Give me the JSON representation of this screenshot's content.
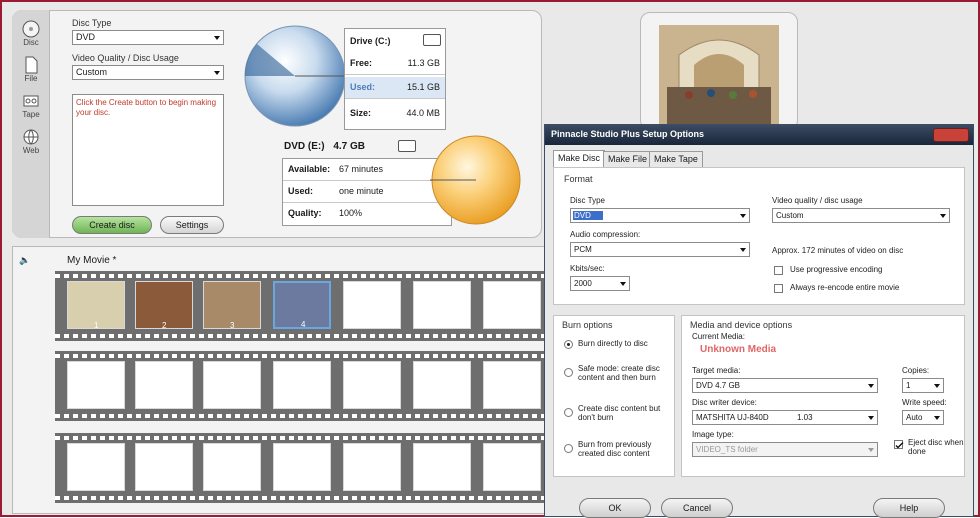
{
  "sidebar": {
    "items": [
      {
        "label": "Disc",
        "icon": "disc-icon"
      },
      {
        "label": "File",
        "icon": "file-icon"
      },
      {
        "label": "Tape",
        "icon": "tape-icon"
      },
      {
        "label": "Web",
        "icon": "web-icon"
      }
    ]
  },
  "disc_panel": {
    "disc_type_label": "Disc Type",
    "disc_type_value": "DVD",
    "quality_label": "Video Quality / Disc Usage",
    "quality_value": "Custom",
    "message": "Click the Create button to begin making your disc.",
    "create_button": "Create disc",
    "settings_button": "Settings"
  },
  "drive_info": {
    "title": "Drive (C:)",
    "free_label": "Free:",
    "free_value": "11.3 GB",
    "used_label": "Used:",
    "used_value": "15.1 GB",
    "size_label": "Size:",
    "size_value": "44.0 MB"
  },
  "dvd_info": {
    "title": "DVD (E:)",
    "capacity": "4.7 GB",
    "available_label": "Available:",
    "available_value": "67 minutes",
    "used_label": "Used:",
    "used_value": "one minute",
    "quality_label": "Quality:",
    "quality_value": "100%"
  },
  "timeline": {
    "title": "My Movie *",
    "clips": [
      "1",
      "2",
      "3",
      "4"
    ]
  },
  "dialog": {
    "title": "Pinnacle Studio Plus Setup Options",
    "tabs": [
      "Make Disc",
      "Make File",
      "Make Tape"
    ],
    "format_group": "Format",
    "disc_type_label": "Disc Type",
    "disc_type_value": "DVD",
    "video_quality_label": "Video quality / disc usage",
    "video_quality_value": "Custom",
    "audio_label": "Audio compression:",
    "audio_value": "PCM",
    "approx_text": "Approx. 172 minutes of video on disc",
    "kbits_label": "Kbits/sec:",
    "kbits_value": "2000",
    "progressive_label": "Use progressive encoding",
    "reencode_label": "Always re-encode entire movie",
    "burn_group": "Burn options",
    "burn_options": [
      "Burn directly to disc",
      "Safe mode: create disc content and then burn",
      "Create disc content but don't burn",
      "Burn from previously created disc content"
    ],
    "media_group": "Media and device options",
    "current_media_label": "Current Media:",
    "current_media_value": "Unknown Media",
    "target_label": "Target media:",
    "target_value": "DVD 4.7 GB",
    "copies_label": "Copies:",
    "copies_value": "1",
    "writer_label": "Disc writer device:",
    "writer_value": "MATSHITA UJ-840D",
    "writer_ver": "1.03",
    "speed_label": "Write speed:",
    "speed_value": "Auto",
    "image_label": "Image type:",
    "image_value": "VIDEO_TS folder",
    "eject_label": "Eject disc when done",
    "ok": "OK",
    "cancel": "Cancel",
    "help": "Help"
  },
  "colors": {
    "frame": "#9b1b35",
    "pie_blue": "#4a7fb8",
    "pie_orange": "#f5a623",
    "dialog_title": "#1e2b40",
    "create_green": "#8dc975",
    "media_red": "#e06666"
  }
}
